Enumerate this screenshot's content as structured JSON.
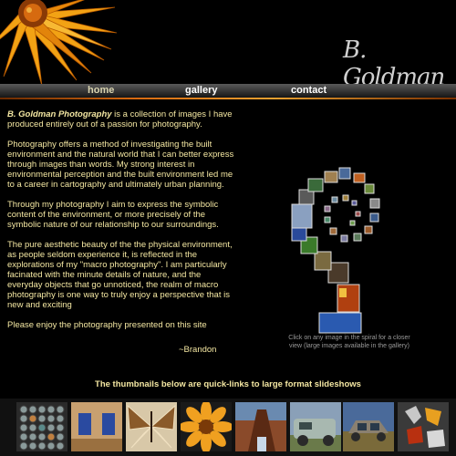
{
  "header": {
    "signature": "B. Goldman"
  },
  "nav": {
    "home": "home",
    "gallery": "gallery",
    "contact": "contact"
  },
  "intro": {
    "brand": "B. Goldman Photography",
    "p1_rest": " is a collection of images I have produced entirely out of a passion for photography.",
    "p2": "Photography offers a method of investigating the built environment and the natural world that I can better express through images than words. My strong interest in environmental perception and the built environment led me to a career in cartography and ultimately urban planning.",
    "p3": "Through my photography I aim to express the symbolic content of the environment, or more precisely of the symbolic nature of our relationship to our surroundings.",
    "p4": "The pure aesthetic beauty of the the physical environment, as people seldom experience it, is reflected in the explorations of my \"macro photography\". I am particularly facinated with the minute details of nature, and the everyday objects that go unnoticed, the realm of macro photography is one way to truly enjoy a perspective that is new and exciting",
    "p5": "Please enjoy the photography presented on this site",
    "signoff": "~Brandon"
  },
  "spiral": {
    "caption": "Click on any image in the spiral for a closer view (large images available in the gallery)"
  },
  "quicklinks": {
    "heading": "The thumbnails below are quick-links to large format slideshows"
  },
  "thumbnails": [
    {
      "name": "thumb-circles"
    },
    {
      "name": "thumb-blue-windows"
    },
    {
      "name": "thumb-butterfly"
    },
    {
      "name": "thumb-orange-flower"
    },
    {
      "name": "thumb-tree-trunk"
    },
    {
      "name": "thumb-old-truck"
    },
    {
      "name": "thumb-rusty-car"
    },
    {
      "name": "thumb-autumn-leaves"
    }
  ],
  "colors": {
    "background": "#000000",
    "text": "#f4e7a2",
    "accent": "#d86a10"
  }
}
